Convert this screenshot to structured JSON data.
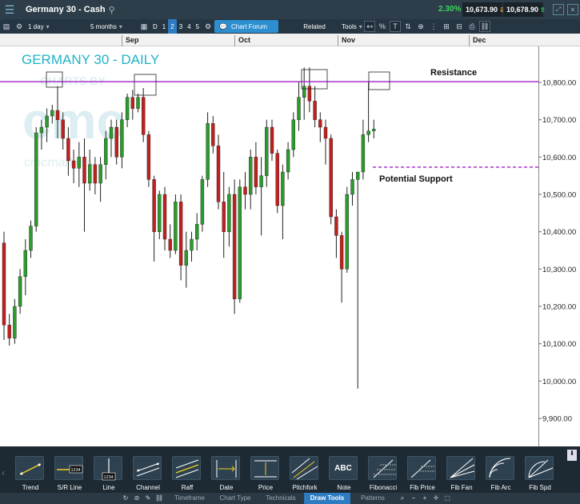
{
  "window": {
    "title": "Germany 30 - Cash",
    "change_pct": "2.30%",
    "sell_price": "10,673.90",
    "buy_price": "10,678.90"
  },
  "toolbar": {
    "interval": "1 day",
    "range": "5 months",
    "periods": [
      "D",
      "1",
      "2",
      "3",
      "4",
      "5"
    ],
    "selected_period": "2",
    "chart_forum": "Chart Forum",
    "related": "Related",
    "tools": "Tools",
    "percent": "%"
  },
  "date_axis": {
    "months": [
      "Sep",
      "Oct",
      "Nov",
      "Dec"
    ]
  },
  "chart": {
    "title": "GERMANY 30 - DAILY",
    "watermark": "CHARTS BY",
    "watermark_logo": "cmc",
    "watermark_sub": "cmcmarkets",
    "resistance_label": "Resistance",
    "support_label": "Potential Support",
    "resistance_color": "#a020c8",
    "support_color": "#a020c8",
    "up_color": "#2b9b2b",
    "down_color": "#c0201e"
  },
  "chart_data": {
    "type": "candlestick",
    "title": "GERMANY 30 - DAILY",
    "y_ticks": [
      "10,800.00",
      "10,700.00",
      "10,600.00",
      "10,500.00",
      "10,400.00",
      "10,300.00",
      "10,200.00",
      "10,100.00",
      "10,000.00",
      "9,900.00"
    ],
    "ylim": [
      9860,
      10890
    ],
    "resistance_level": 10802,
    "support_level": 10573,
    "candles": [
      [
        10370,
        10400,
        10110,
        10150
      ],
      [
        10150,
        10180,
        10095,
        10115
      ],
      [
        10115,
        10220,
        10100,
        10200
      ],
      [
        10200,
        10300,
        10180,
        10280
      ],
      [
        10280,
        10380,
        10230,
        10350
      ],
      [
        10350,
        10430,
        10330,
        10415
      ],
      [
        10415,
        10680,
        10400,
        10665
      ],
      [
        10665,
        10700,
        10620,
        10680
      ],
      [
        10680,
        10730,
        10640,
        10710
      ],
      [
        10710,
        10740,
        10690,
        10725
      ],
      [
        10725,
        10790,
        10650,
        10700
      ],
      [
        10700,
        10720,
        10620,
        10650
      ],
      [
        10650,
        10680,
        10550,
        10590
      ],
      [
        10590,
        10620,
        10530,
        10570
      ],
      [
        10570,
        10640,
        10520,
        10600
      ],
      [
        10600,
        10650,
        10400,
        10530
      ],
      [
        10530,
        10620,
        10510,
        10580
      ],
      [
        10580,
        10600,
        10500,
        10530
      ],
      [
        10530,
        10600,
        10480,
        10580
      ],
      [
        10580,
        10670,
        10540,
        10650
      ],
      [
        10650,
        10700,
        10600,
        10680
      ],
      [
        10680,
        10700,
        10580,
        10600
      ],
      [
        10600,
        10720,
        10570,
        10700
      ],
      [
        10700,
        10770,
        10680,
        10760
      ],
      [
        10760,
        10780,
        10700,
        10730
      ],
      [
        10730,
        10770,
        10720,
        10760
      ],
      [
        10760,
        10785,
        10640,
        10660
      ],
      [
        10660,
        10670,
        10520,
        10540
      ],
      [
        10540,
        10550,
        10320,
        10400
      ],
      [
        10400,
        10510,
        10380,
        10500
      ],
      [
        10500,
        10520,
        10350,
        10380
      ],
      [
        10380,
        10420,
        10330,
        10350
      ],
      [
        10350,
        10500,
        10340,
        10480
      ],
      [
        10480,
        10500,
        10270,
        10310
      ],
      [
        10310,
        10400,
        10250,
        10350
      ],
      [
        10350,
        10400,
        10320,
        10380
      ],
      [
        10380,
        10450,
        10350,
        10420
      ],
      [
        10420,
        10550,
        10400,
        10540
      ],
      [
        10540,
        10720,
        10520,
        10690
      ],
      [
        10690,
        10710,
        10610,
        10630
      ],
      [
        10630,
        10660,
        10460,
        10480
      ],
      [
        10480,
        10560,
        10330,
        10400
      ],
      [
        10400,
        10520,
        10360,
        10500
      ],
      [
        10500,
        10540,
        10180,
        10220
      ],
      [
        10220,
        10540,
        10210,
        10520
      ],
      [
        10520,
        10560,
        10460,
        10500
      ],
      [
        10500,
        10620,
        10460,
        10600
      ],
      [
        10600,
        10640,
        10500,
        10520
      ],
      [
        10520,
        10600,
        10390,
        10550
      ],
      [
        10550,
        10700,
        10520,
        10680
      ],
      [
        10680,
        10700,
        10590,
        10610
      ],
      [
        10610,
        10620,
        10450,
        10470
      ],
      [
        10470,
        10580,
        10380,
        10560
      ],
      [
        10560,
        10640,
        10540,
        10620
      ],
      [
        10620,
        10720,
        10600,
        10700
      ],
      [
        10700,
        10800,
        10670,
        10760
      ],
      [
        10760,
        10840,
        10700,
        10790
      ],
      [
        10790,
        10840,
        10720,
        10750
      ],
      [
        10750,
        10790,
        10680,
        10700
      ],
      [
        10700,
        10720,
        10640,
        10680
      ],
      [
        10680,
        10700,
        10580,
        10650
      ],
      [
        10650,
        10660,
        10420,
        10440
      ],
      [
        10440,
        10460,
        10330,
        10390
      ],
      [
        10390,
        10400,
        10210,
        10300
      ],
      [
        10300,
        10520,
        10290,
        10500
      ],
      [
        10500,
        10560,
        10470,
        10540
      ],
      [
        10540,
        10560,
        9980,
        10560
      ],
      [
        10560,
        10700,
        10540,
        10660
      ],
      [
        10660,
        10800,
        10640,
        10670
      ],
      [
        10670,
        10700,
        10650,
        10675
      ]
    ]
  },
  "draw_tools": [
    {
      "label": "Trend",
      "icon": "trend-line-icon"
    },
    {
      "label": "S/R Line",
      "icon": "sr-line-icon"
    },
    {
      "label": "Line",
      "icon": "vertical-line-icon"
    },
    {
      "label": "Channel",
      "icon": "channel-icon"
    },
    {
      "label": "Raff",
      "icon": "raff-channel-icon"
    },
    {
      "label": "Date",
      "icon": "date-range-icon"
    },
    {
      "label": "Price",
      "icon": "price-range-icon"
    },
    {
      "label": "Pitchfork",
      "icon": "pitchfork-icon"
    },
    {
      "label": "Note",
      "icon": "note-icon",
      "text": "ABC"
    },
    {
      "label": "Fibonacci",
      "icon": "fibonacci-icon"
    },
    {
      "label": "Fib Price",
      "icon": "fib-price-icon"
    },
    {
      "label": "Fib Fan",
      "icon": "fib-fan-icon"
    },
    {
      "label": "Fib Arc",
      "icon": "fib-arc-icon"
    },
    {
      "label": "Fib Spd",
      "icon": "fib-speed-icon"
    }
  ],
  "sr_line_badge": "1234",
  "line_badge": "1234",
  "bottom_tabs": [
    {
      "label": "Timeframe",
      "selected": false
    },
    {
      "label": "Chart Type",
      "selected": false
    },
    {
      "label": "Technicals",
      "selected": false
    },
    {
      "label": "Draw Tools",
      "selected": true
    },
    {
      "label": "Patterns",
      "selected": false
    }
  ]
}
